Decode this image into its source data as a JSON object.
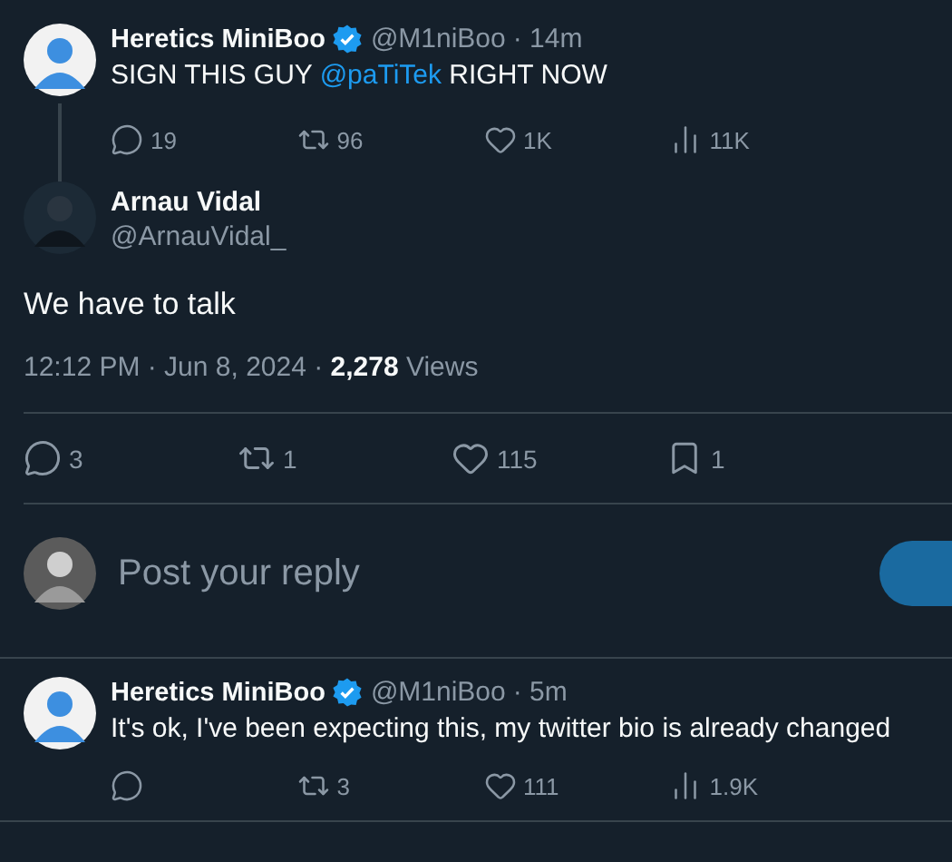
{
  "tweets": [
    {
      "kind": "parent",
      "author": "Heretics MiniBoo",
      "verified": true,
      "handle": "@M1niBoo",
      "time": "· 14m",
      "text": [
        {
          "kind": "text",
          "value": "SIGN THIS GUY "
        },
        {
          "kind": "mention",
          "value": "@paTiTek"
        },
        {
          "kind": "text",
          "value": " RIGHT NOW"
        }
      ],
      "actions": [
        {
          "kind": "reply",
          "count": "19"
        },
        {
          "kind": "repost",
          "count": "96"
        },
        {
          "kind": "like",
          "count": "1K"
        },
        {
          "kind": "views",
          "count": "11K"
        }
      ]
    },
    {
      "kind": "main",
      "author": "Arnau Vidal",
      "handle": "@ArnauVidal_",
      "body": "We have to talk",
      "meta": "12:12 PM · Jun 8, 2024 · **2,278** Views",
      "actions": [
        {
          "kind": "reply",
          "count": "3"
        },
        {
          "kind": "repost",
          "count": "1"
        },
        {
          "kind": "like",
          "count": "115"
        },
        {
          "kind": "bookmark",
          "count": "1"
        }
      ]
    }
  ],
  "composer": {
    "placeholder": "Post your reply"
  },
  "replies": [
    {
      "author": "Heretics MiniBoo",
      "verified": true,
      "handle": "@M1niBoo",
      "time": "· 5m",
      "text": [
        {
          "kind": "text",
          "value": "It's ok, I've been expecting this, my twitter bio is already changed"
        }
      ],
      "actions": [
        {
          "kind": "reply"
        },
        {
          "kind": "repost",
          "count": "3"
        },
        {
          "kind": "like",
          "count": "111"
        },
        {
          "kind": "views",
          "count": "1.9K"
        }
      ]
    }
  ]
}
